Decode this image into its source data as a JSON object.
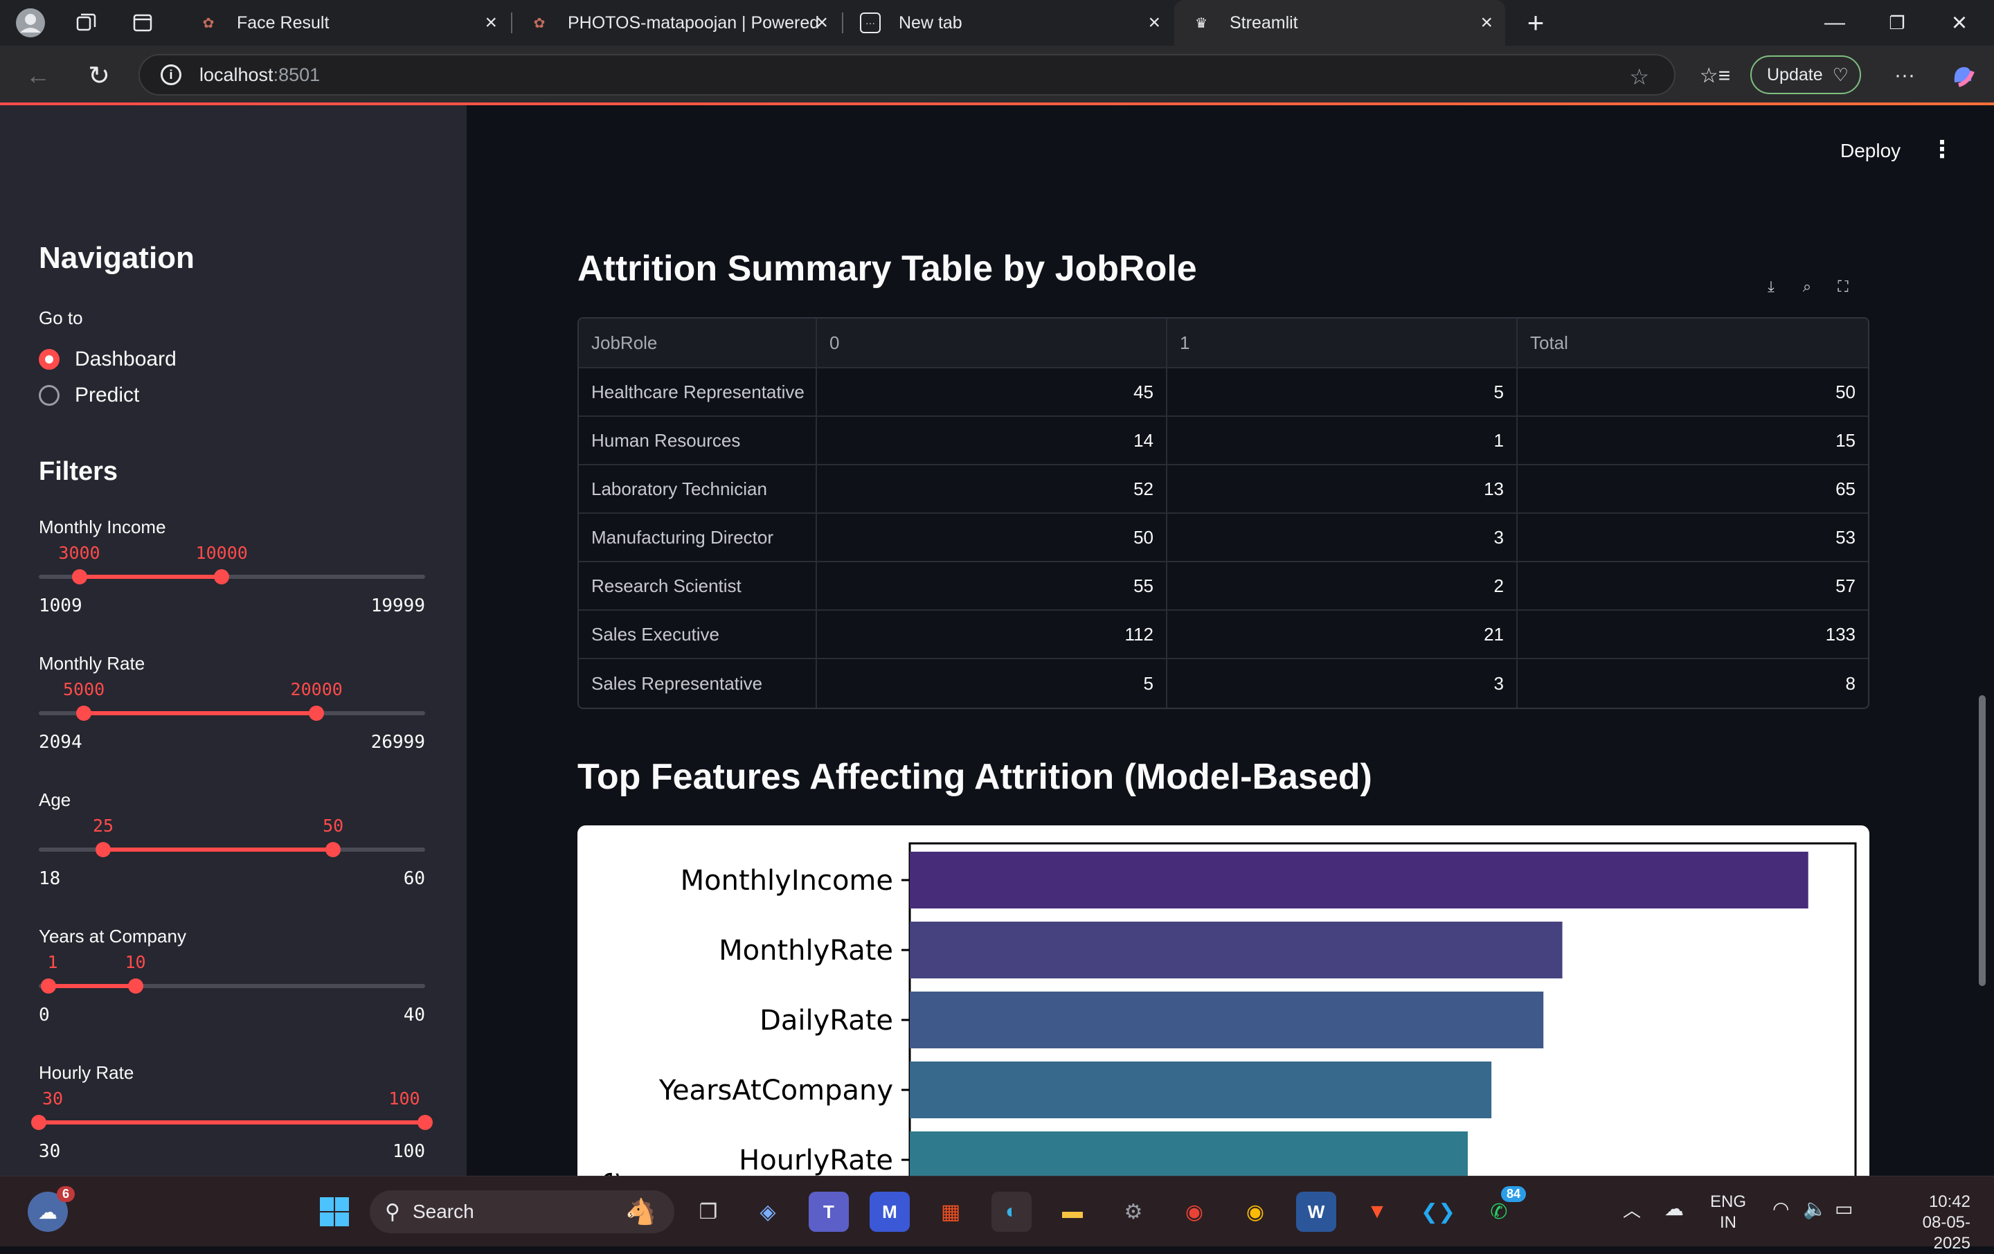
{
  "browser": {
    "tabs": [
      {
        "title": "Face Result"
      },
      {
        "title": "PHOTOS-matapoojan | Powered By"
      },
      {
        "title": "New tab"
      },
      {
        "title": "Streamlit"
      }
    ],
    "url_host": "localhost",
    "url_port": ":8501",
    "update_label": "Update"
  },
  "app": {
    "deploy_label": "Deploy",
    "sidebar": {
      "nav_title": "Navigation",
      "goto_label": "Go to",
      "options": [
        "Dashboard",
        "Predict"
      ],
      "selected": "Dashboard",
      "filters_title": "Filters",
      "sliders": [
        {
          "label": "Monthly Income",
          "min": "1009",
          "max": "19999",
          "lo": "3000",
          "hi": "10000",
          "min_v": 1009,
          "max_v": 19999,
          "lo_v": 3000,
          "hi_v": 10000
        },
        {
          "label": "Monthly Rate",
          "min": "2094",
          "max": "26999",
          "lo": "5000",
          "hi": "20000",
          "min_v": 2094,
          "max_v": 26999,
          "lo_v": 5000,
          "hi_v": 20000
        },
        {
          "label": "Age",
          "min": "18",
          "max": "60",
          "lo": "25",
          "hi": "50",
          "min_v": 18,
          "max_v": 60,
          "lo_v": 25,
          "hi_v": 50
        },
        {
          "label": "Years at Company",
          "min": "0",
          "max": "40",
          "lo": "1",
          "hi": "10",
          "min_v": 0,
          "max_v": 40,
          "lo_v": 1,
          "hi_v": 10
        },
        {
          "label": "Hourly Rate",
          "min": "30",
          "max": "100",
          "lo": "30",
          "hi": "100",
          "min_v": 30,
          "max_v": 100,
          "lo_v": 30,
          "hi_v": 100
        }
      ]
    },
    "table_section": {
      "title": "Attrition Summary Table by JobRole",
      "columns": [
        "JobRole",
        "0",
        "1",
        "Total"
      ],
      "rows": [
        [
          "Healthcare Representative",
          "45",
          "5",
          "50"
        ],
        [
          "Human Resources",
          "14",
          "1",
          "15"
        ],
        [
          "Laboratory Technician",
          "52",
          "13",
          "65"
        ],
        [
          "Manufacturing Director",
          "50",
          "3",
          "53"
        ],
        [
          "Research Scientist",
          "55",
          "2",
          "57"
        ],
        [
          "Sales Executive",
          "112",
          "21",
          "133"
        ],
        [
          "Sales Representative",
          "5",
          "3",
          "8"
        ]
      ]
    },
    "chart_section": {
      "title": "Top Features Affecting Attrition (Model-Based)"
    }
  },
  "chart_data": {
    "type": "bar",
    "orientation": "horizontal",
    "categories": [
      "MonthlyIncome",
      "MonthlyRate",
      "DailyRate",
      "YearsAtCompany",
      "HourlyRate"
    ],
    "values": [
      0.95,
      0.69,
      0.67,
      0.615,
      0.59
    ],
    "xlim": [
      0,
      1.0
    ],
    "ylabel": "re",
    "colors": [
      "#472c7a",
      "#46427f",
      "#3f5a8a",
      "#36698c",
      "#2f7a8c"
    ]
  },
  "taskbar": {
    "search_label": "Search",
    "lang_top": "ENG",
    "lang_bottom": "IN",
    "time": "10:42",
    "date": "08-05-2025",
    "weather_badge": "6",
    "whatsapp_badge": "84"
  }
}
